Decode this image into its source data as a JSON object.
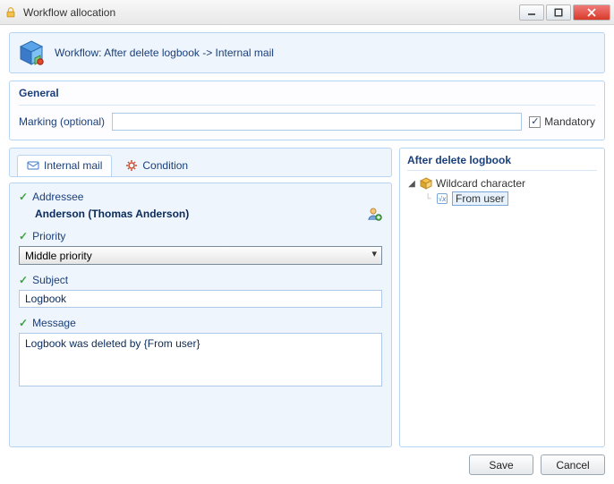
{
  "window": {
    "title": "Workflow allocation"
  },
  "workflow": {
    "line": "Workflow: After delete logbook -> Internal mail"
  },
  "general": {
    "title": "General",
    "marking_label": "Marking (optional)",
    "marking_value": "",
    "mandatory_label": "Mandatory",
    "mandatory_checked": true
  },
  "tabs": [
    {
      "label": "Internal mail",
      "active": true
    },
    {
      "label": "Condition",
      "active": false
    }
  ],
  "form": {
    "addressee_label": "Addressee",
    "addressee_value": "Anderson (Thomas Anderson)",
    "priority_label": "Priority",
    "priority_value": "Middle priority",
    "subject_label": "Subject",
    "subject_value": "Logbook",
    "message_label": "Message",
    "message_value": "Logbook was deleted by {From user}"
  },
  "tree": {
    "title": "After delete logbook",
    "root": "Wildcard character",
    "child": "From user"
  },
  "footer": {
    "save": "Save",
    "cancel": "Cancel"
  }
}
